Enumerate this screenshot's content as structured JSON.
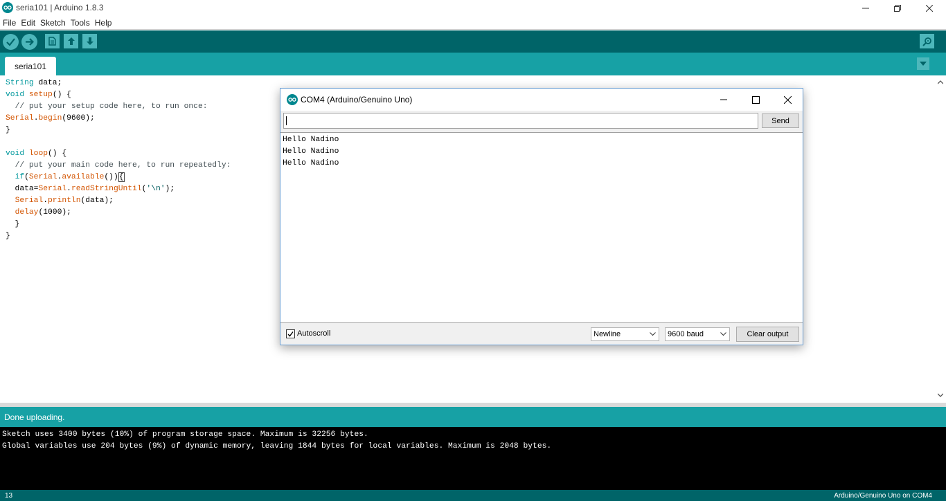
{
  "window": {
    "title": "seria101 | Arduino 1.8.3",
    "logo_icon": "arduino-logo-icon"
  },
  "menu": [
    "File",
    "Edit",
    "Sketch",
    "Tools",
    "Help"
  ],
  "toolbar": {
    "buttons": [
      "verify-icon",
      "upload-icon",
      "new-icon",
      "open-icon",
      "save-icon",
      "serial-monitor-icon"
    ]
  },
  "tabs": [
    {
      "label": "seria101"
    }
  ],
  "code": {
    "lines": [
      "String data;",
      "void setup() {",
      "  // put your setup code here, to run once:",
      "Serial.begin(9600);",
      "}",
      "",
      "void loop() {",
      "  // put your main code here, to run repeatedly:",
      "  if(Serial.available()){",
      "  data=Serial.readStringUntil('\\n');",
      "  Serial.println(data);",
      "  delay(1000);",
      "  }",
      "}"
    ]
  },
  "status": {
    "message": "Done uploading."
  },
  "console": {
    "lines": [
      "Sketch uses 3400 bytes (10%) of program storage space. Maximum is 32256 bytes.",
      "Global variables use 204 bytes (9%) of dynamic memory, leaving 1844 bytes for local variables. Maximum is 2048 bytes."
    ]
  },
  "footer": {
    "line_number": "13",
    "board": "Arduino/Genuino Uno on COM4"
  },
  "serial_monitor": {
    "title": "COM4 (Arduino/Genuino Uno)",
    "input_value": "",
    "send_label": "Send",
    "output_lines": [
      "Hello Nadino",
      "Hello Nadino",
      "Hello Nadino"
    ],
    "autoscroll_label": "Autoscroll",
    "autoscroll_checked": true,
    "line_ending": "Newline",
    "baud": "9600 baud",
    "clear_label": "Clear output"
  },
  "colors": {
    "toolbar": "#006468",
    "tabbar": "#17a1a5",
    "button": "#4db7bb",
    "keyword": "#00979c",
    "function": "#d35400"
  }
}
